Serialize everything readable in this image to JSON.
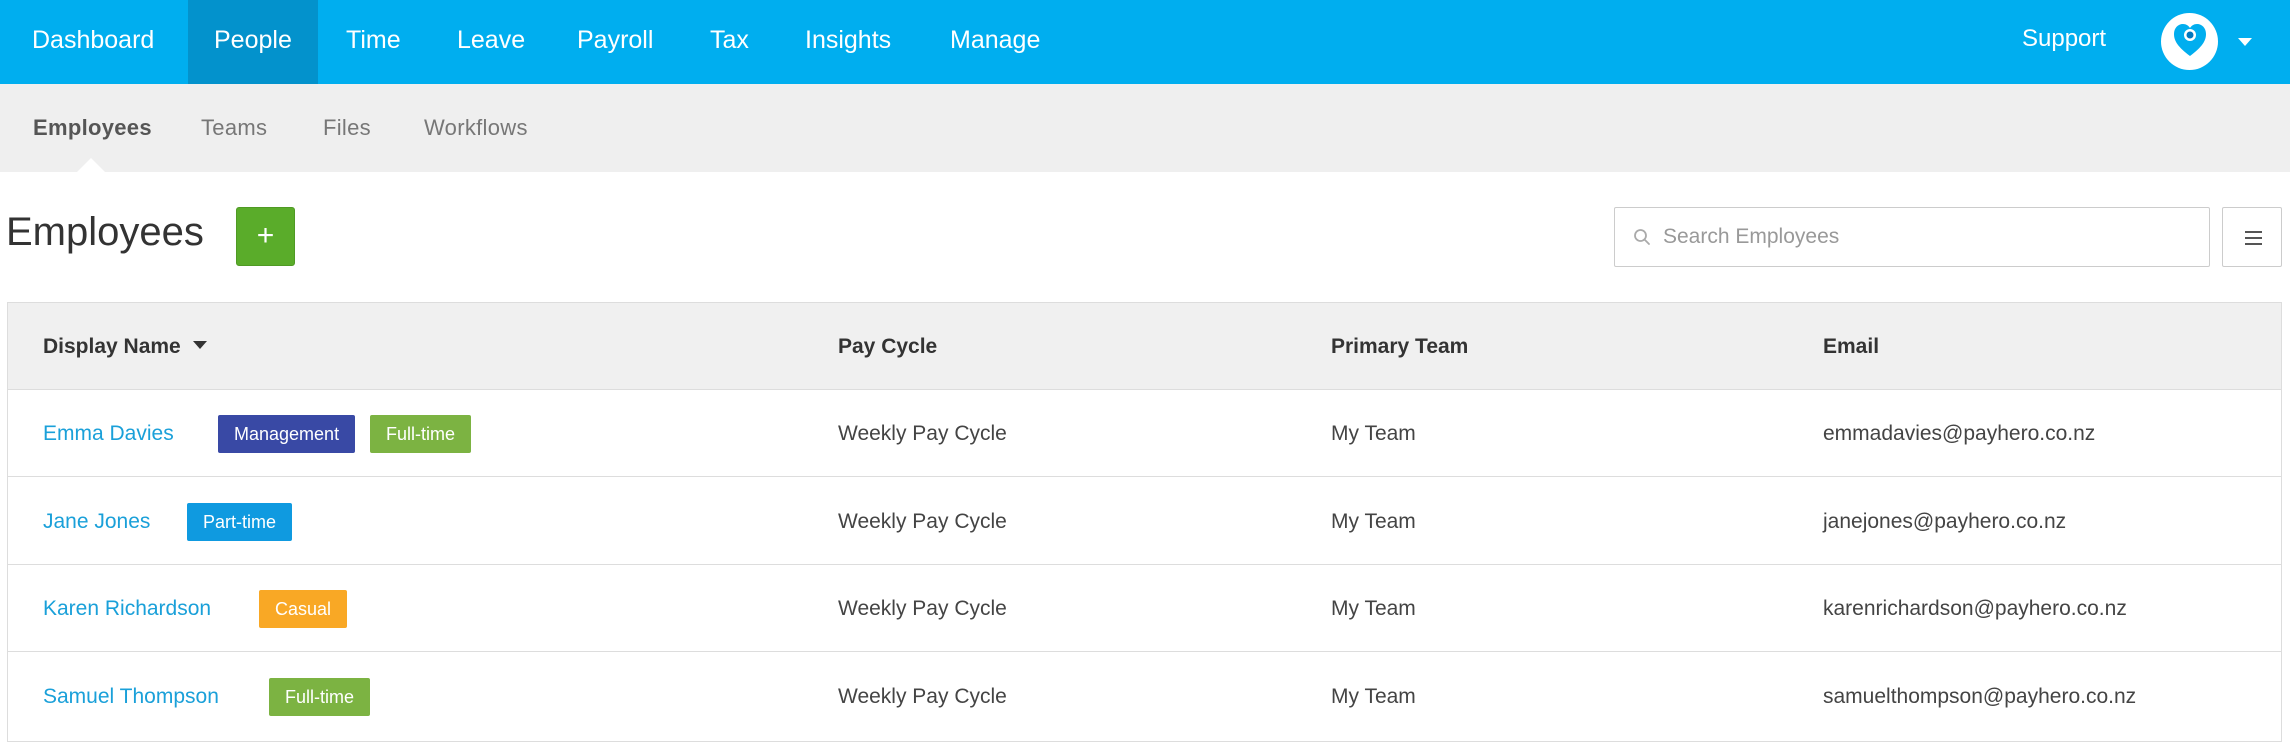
{
  "topnav": {
    "items": [
      "Dashboard",
      "People",
      "Time",
      "Leave",
      "Payroll",
      "Tax",
      "Insights",
      "Manage"
    ],
    "active_index": 1,
    "support_label": "Support"
  },
  "subnav": {
    "items": [
      "Employees",
      "Teams",
      "Files",
      "Workflows"
    ],
    "active_index": 0
  },
  "page": {
    "title": "Employees",
    "add_label": "+",
    "search_placeholder": "Search Employees"
  },
  "table": {
    "columns": [
      "Display Name",
      "Pay Cycle",
      "Primary Team",
      "Email"
    ],
    "sorted_column": "Display Name",
    "rows": [
      {
        "name": "Emma Davies",
        "tags": [
          {
            "label": "Management",
            "color": "#3949a5"
          },
          {
            "label": "Full-time",
            "color": "#7cb342"
          }
        ],
        "pay_cycle": "Weekly Pay Cycle",
        "team": "My Team",
        "email": "emmadavies@payhero.co.nz"
      },
      {
        "name": "Jane Jones",
        "tags": [
          {
            "label": "Part-time",
            "color": "#0f9ae0"
          }
        ],
        "pay_cycle": "Weekly Pay Cycle",
        "team": "My Team",
        "email": "janejones@payhero.co.nz"
      },
      {
        "name": "Karen Richardson",
        "tags": [
          {
            "label": "Casual",
            "color": "#f9a825"
          }
        ],
        "pay_cycle": "Weekly Pay Cycle",
        "team": "My Team",
        "email": "karenrichardson@payhero.co.nz"
      },
      {
        "name": "Samuel Thompson",
        "tags": [
          {
            "label": "Full-time",
            "color": "#7cb342"
          }
        ],
        "pay_cycle": "Weekly Pay Cycle",
        "team": "My Team",
        "email": "samuelthompson@payhero.co.nz"
      }
    ]
  },
  "colors": {
    "nav_bg": "#00aeef",
    "nav_active": "#0392cc",
    "add_button": "#5aac2a",
    "link": "#1aa0d9"
  },
  "icons": {
    "avatar": "payhero-heart-icon",
    "search": "search-icon",
    "menu": "hamburger-menu-icon"
  }
}
